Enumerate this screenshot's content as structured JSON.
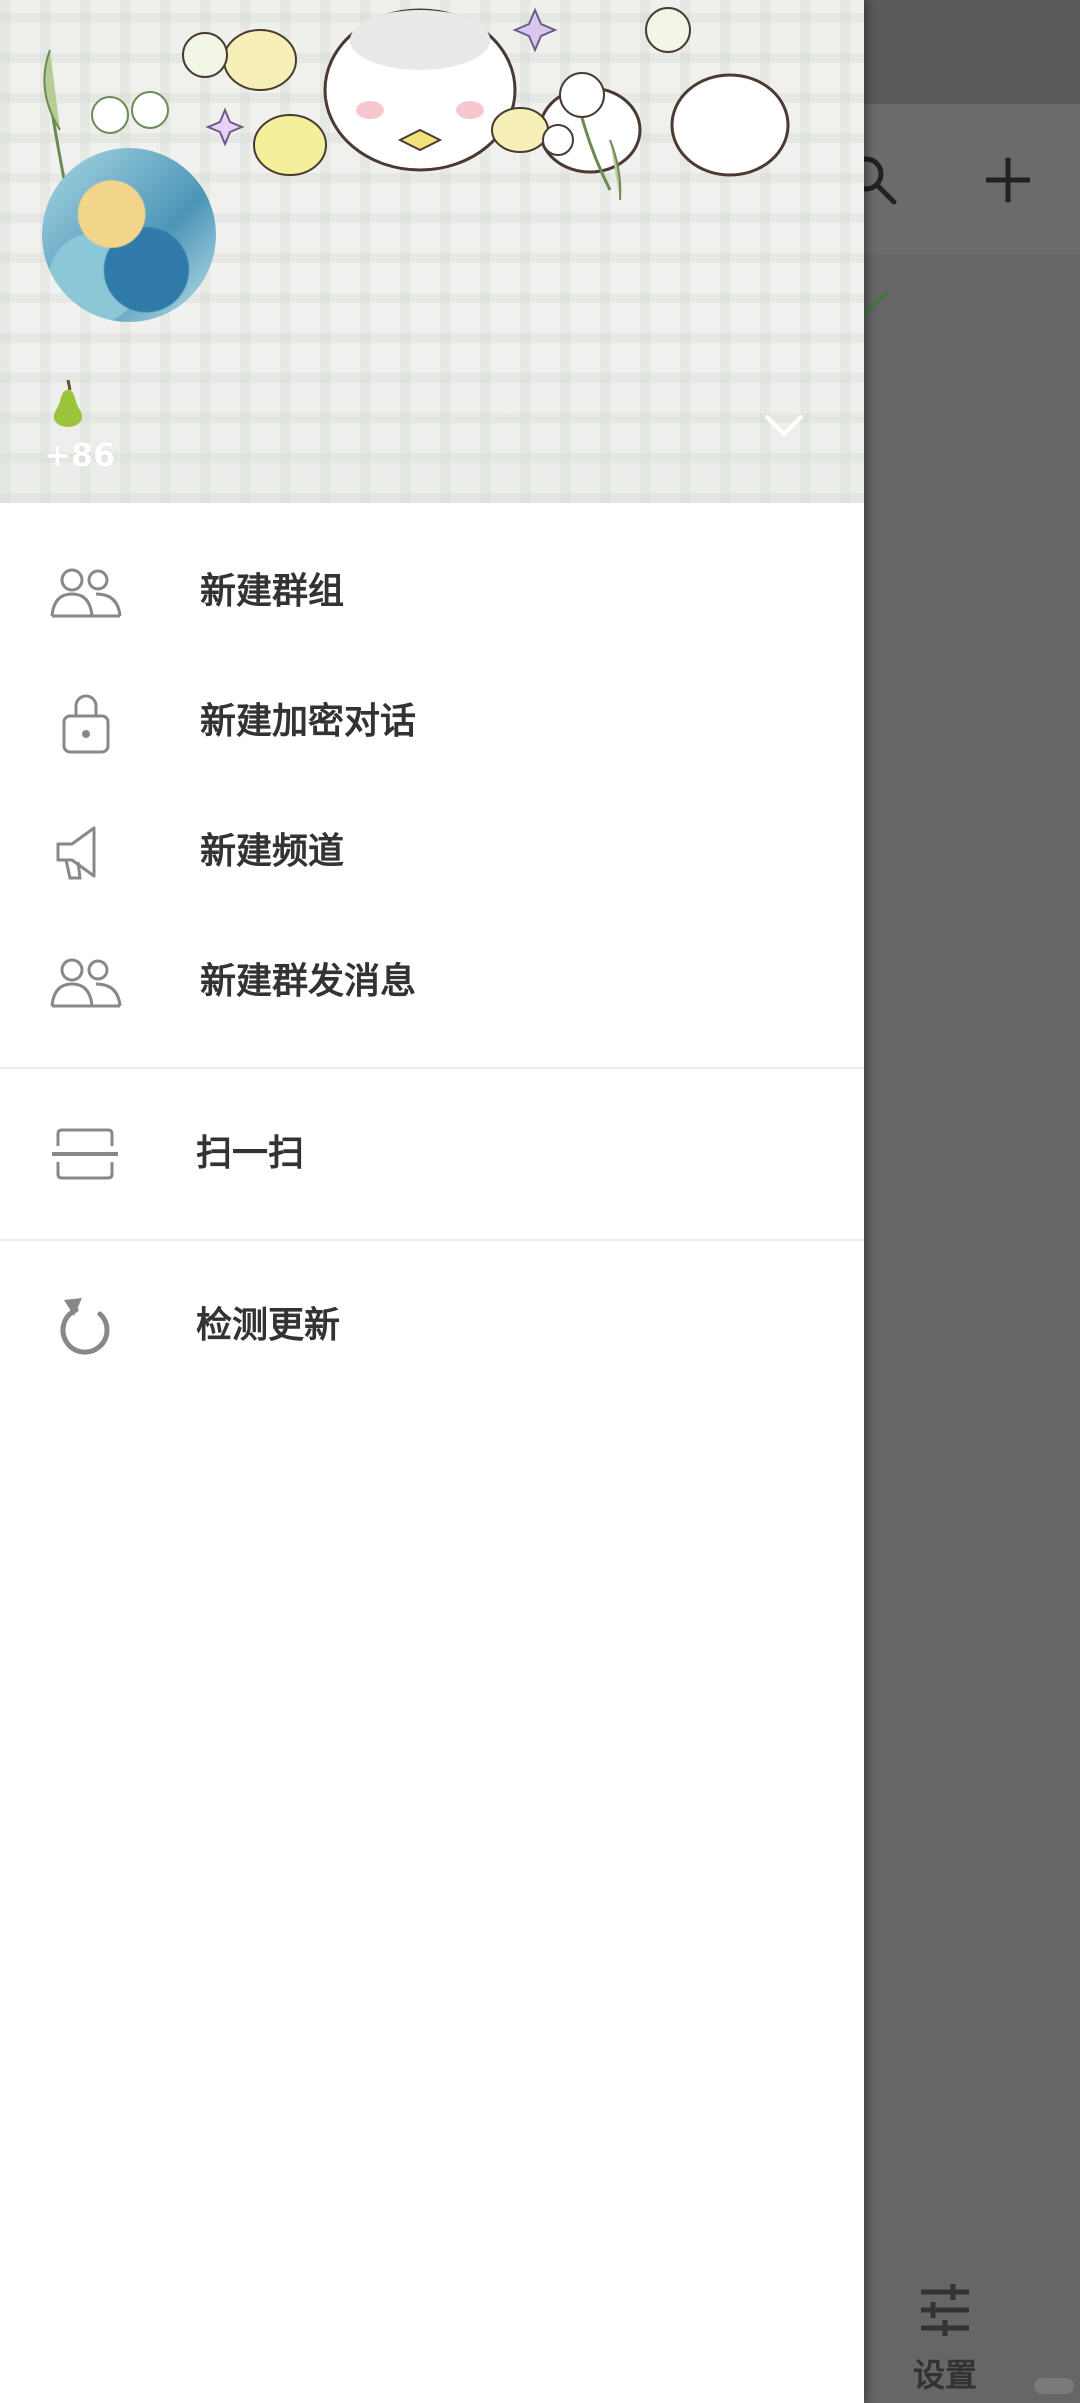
{
  "header": {
    "phone": "+86"
  },
  "menu_group_1": [
    {
      "label": "新建群组",
      "icon": "group-icon"
    },
    {
      "label": "新建加密对话",
      "icon": "lock-icon"
    },
    {
      "label": "新建频道",
      "icon": "megaphone-icon"
    },
    {
      "label": "新建群发消息",
      "icon": "group-icon"
    }
  ],
  "menu_group_2": [
    {
      "label": "扫一扫",
      "icon": "scan-icon"
    }
  ],
  "menu_group_3": [
    {
      "label": "检测更新",
      "icon": "refresh-icon"
    }
  ],
  "background_app": {
    "settings_label": "设置"
  },
  "colors": {
    "menu_text": "#333333",
    "icon_gray": "#888888",
    "scrim": "#666666"
  }
}
